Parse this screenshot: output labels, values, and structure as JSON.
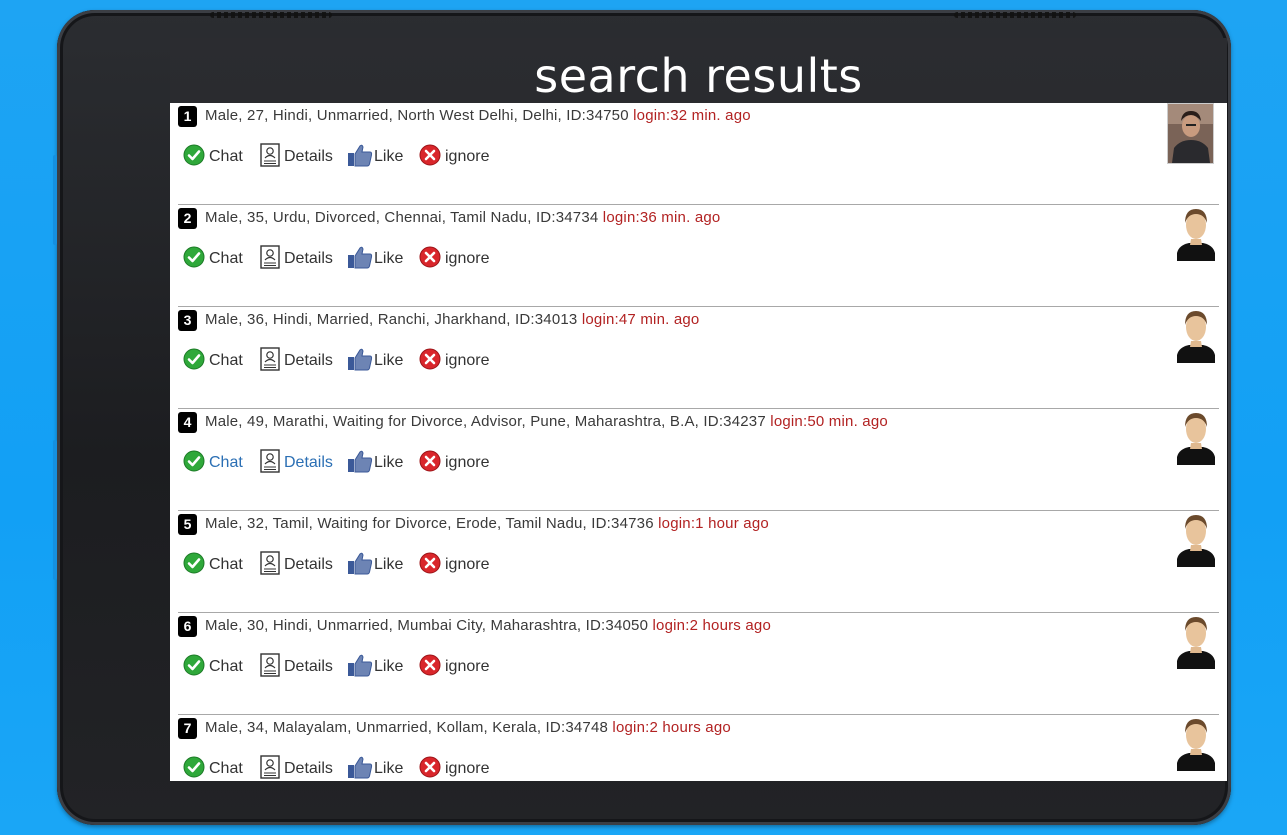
{
  "header": {
    "title": "search results"
  },
  "results": [
    {
      "num": "1",
      "info": "Male, 27, Hindi, Unmarried, North West Delhi, Delhi, ID:34750",
      "login": "login:32 min. ago",
      "has_photo": true
    },
    {
      "num": "2",
      "info": "Male, 35, Urdu, Divorced, Chennai, Tamil Nadu, ID:34734",
      "login": "login:36 min. ago",
      "has_photo": false
    },
    {
      "num": "3",
      "info": "Male, 36, Hindi, Married, Ranchi, Jharkhand, ID:34013",
      "login": "login:47 min. ago",
      "has_photo": false
    },
    {
      "num": "4",
      "info": "Male, 49, Marathi, Waiting for Divorce, Advisor, Pune, Maharashtra, B.A, ID:34237",
      "login": "login:50 min. ago",
      "has_photo": false
    },
    {
      "num": "5",
      "info": "Male, 32, Tamil, Waiting for Divorce, Erode, Tamil Nadu, ID:34736",
      "login": "login:1 hour ago",
      "has_photo": false
    },
    {
      "num": "6",
      "info": "Male, 30, Hindi, Unmarried, Mumbai City, Maharashtra, ID:34050",
      "login": "login:2 hours ago",
      "has_photo": false
    },
    {
      "num": "7",
      "info": "Male, 34, Malayalam, Unmarried, Kollam, Kerala, ID:34748",
      "login": "login:2 hours ago",
      "has_photo": false
    }
  ],
  "actions": {
    "chat": "Chat",
    "details": "Details",
    "like": "Like",
    "ignore": "ignore"
  },
  "colors": {
    "login": "#b22222",
    "background": "#12a0f5",
    "check": "#2fa83a",
    "ignore": "#d9262b"
  }
}
